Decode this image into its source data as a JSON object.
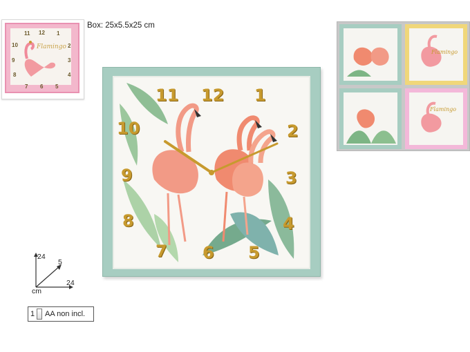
{
  "box_label": "Box: 25x5.5x25 cm",
  "thumbnail": {
    "numbers": [
      "12",
      "11",
      "1",
      "10",
      "2",
      "9",
      "3",
      "8",
      "4",
      "7",
      "6",
      "5"
    ],
    "script_text": "Flamingo"
  },
  "clock": {
    "numbers": {
      "n12": "12",
      "n11": "11",
      "n1": "1",
      "n10": "10",
      "n2": "2",
      "n9": "9",
      "n3": "3",
      "n8": "8",
      "n4": "4",
      "n7": "7",
      "n6": "6",
      "n5": "5"
    }
  },
  "variants": {
    "items": [
      {
        "frame": "#a7cdc1",
        "script": ""
      },
      {
        "frame": "#f0d77a",
        "script": "Flamingo"
      },
      {
        "frame": "#a7cdc1",
        "script": ""
      },
      {
        "frame": "#f3b8d9",
        "script": "Flamingo"
      }
    ]
  },
  "dimensions": {
    "height": "24",
    "depth": "5",
    "width": "24",
    "unit": "cm"
  },
  "battery": {
    "count": "1",
    "text": "AA non incl."
  },
  "colors": {
    "gold": "#c79a2e",
    "mint": "#a7cdc1",
    "pink": "#f3b8cc",
    "flamingo": "#f08a6f"
  }
}
